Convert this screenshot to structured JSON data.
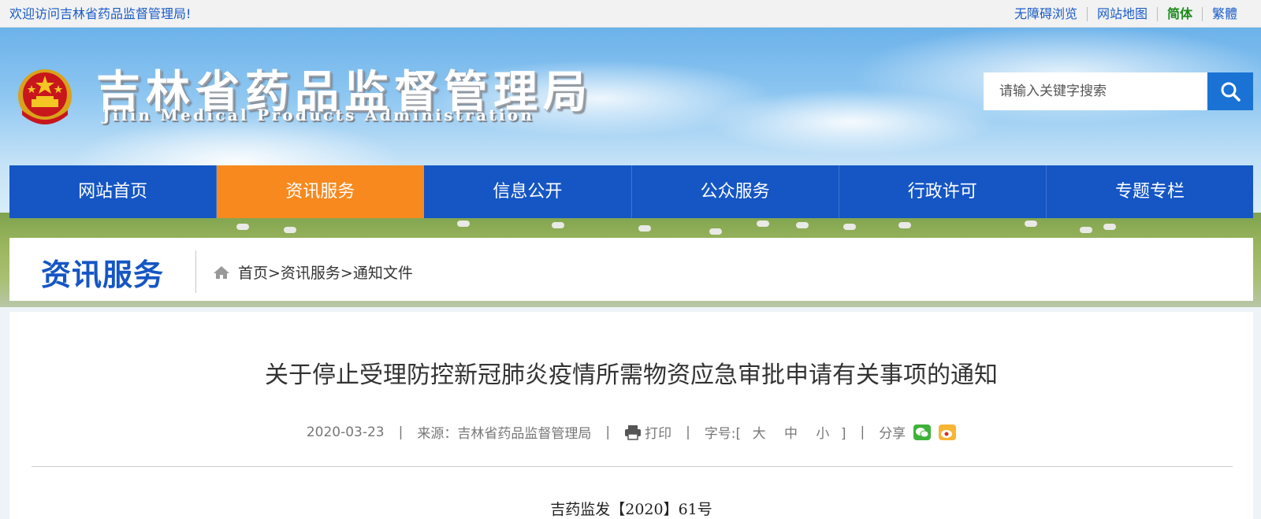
{
  "topbar": {
    "welcome": "欢迎访问吉林省药品监督管理局!",
    "links": [
      "无障碍浏览",
      "网站地图",
      "简体",
      "繁體"
    ]
  },
  "header": {
    "site_title_cn": "吉林省药品监督管理局",
    "site_title_en": "Jilin Medical Products Administration",
    "emblem_icon": "national-emblem-icon"
  },
  "search": {
    "placeholder": "请输入关键字搜索",
    "icon": "search-icon"
  },
  "nav": {
    "items": [
      "网站首页",
      "资讯服务",
      "信息公开",
      "公众服务",
      "行政许可",
      "专题专栏"
    ],
    "active": "资讯服务"
  },
  "section": {
    "title": "资讯服务",
    "breadcrumb": "首页>资讯服务>通知文件",
    "home_icon": "home-icon"
  },
  "article": {
    "title": "关于停止受理防控新冠肺炎疫情所需物资应急审批申请有关事项的通知",
    "date": "2020-03-23",
    "source_label": "来源：",
    "source": "吉林省药品监督管理局",
    "print_label": "打印",
    "font_size_label": "字号:[",
    "font_sizes": [
      "大",
      "中",
      "小"
    ],
    "font_size_close": "]",
    "share_label": "分享",
    "share_icons": [
      "wechat-icon",
      "weibo-icon"
    ],
    "doc_number": "吉药监发【2020】61号"
  },
  "colors": {
    "nav_blue": "#1556c4",
    "nav_active": "#f7891e",
    "search_button": "#1a73d4",
    "link_blue": "#1a5cc8"
  }
}
